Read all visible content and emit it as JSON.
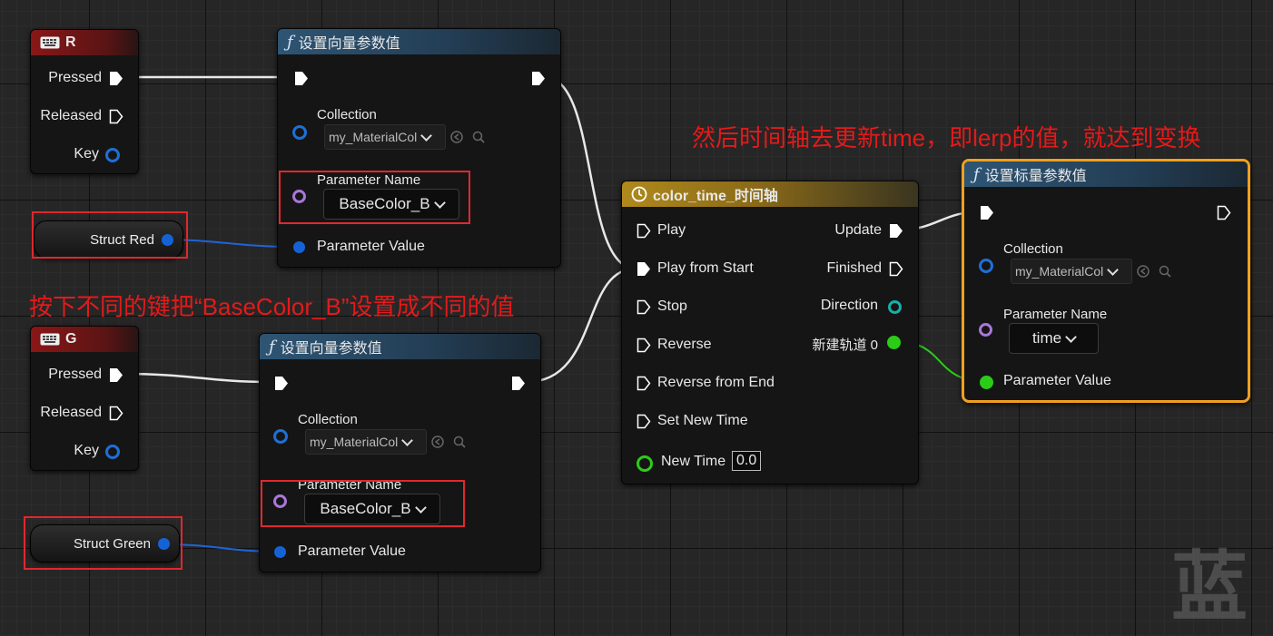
{
  "annotations": {
    "top_right": "然后时间轴去更新time，即lerp的值，就达到变换",
    "middle_left": "按下不同的键把“BaseColor_B”设置成不同的值"
  },
  "key_event_r": {
    "title": "R",
    "pins": [
      "Pressed",
      "Released",
      "Key"
    ]
  },
  "key_event_g": {
    "title": "G",
    "pins": [
      "Pressed",
      "Released",
      "Key"
    ]
  },
  "variables": {
    "struct_red": "Struct Red",
    "struct_green": "Struct Green"
  },
  "set_vector_top": {
    "title": "设置向量参数值",
    "collection_label": "Collection",
    "collection_value": "my_MaterialCol",
    "param_name_label": "Parameter Name",
    "param_name_value": "BaseColor_B",
    "param_value_label": "Parameter Value"
  },
  "set_vector_bottom": {
    "title": "设置向量参数值",
    "collection_label": "Collection",
    "collection_value": "my_MaterialCol",
    "param_name_label": "Parameter Name",
    "param_name_value": "BaseColor_B",
    "param_value_label": "Parameter Value"
  },
  "timeline": {
    "title": "color_time_时间轴",
    "inputs": [
      "Play",
      "Play from Start",
      "Stop",
      "Reverse",
      "Reverse from End",
      "Set New Time"
    ],
    "new_time_label": "New Time",
    "new_time_value": "0.0",
    "outputs": [
      "Update",
      "Finished",
      "Direction",
      "新建轨道 0"
    ]
  },
  "set_scalar": {
    "title": "设置标量参数值",
    "collection_label": "Collection",
    "collection_value": "my_MaterialCol",
    "param_name_label": "Parameter Name",
    "param_name_value": "time",
    "param_value_label": "Parameter Value"
  },
  "colors": {
    "exec_wire": "#ffffff",
    "vector_wire": "#1f64d6",
    "float_wire": "#2bcc18",
    "highlight": "#e0282e",
    "selected_border": "#f0a020"
  },
  "watermark": "蓝"
}
